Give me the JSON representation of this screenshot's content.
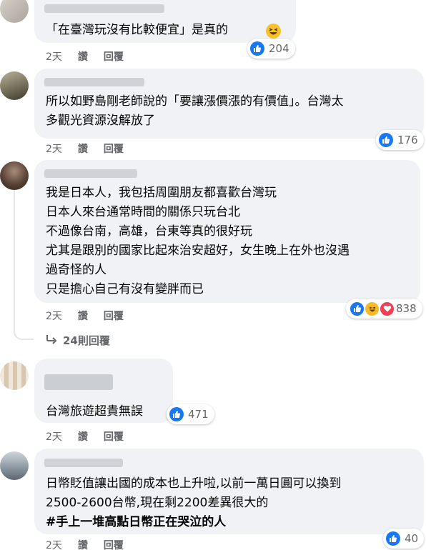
{
  "comments": [
    {
      "lines": [
        "「在臺灣玩沒有比較便宜」是真的"
      ],
      "emoji": "grin-squint-emoji",
      "time": "2天",
      "like_label": "讚",
      "reply_label": "回覆",
      "reaction_count": "204",
      "reactions": [
        "like"
      ]
    },
    {
      "lines": [
        "所以如野島剛老師說的「要讓漲價漲的有價值」。台灣太",
        "多觀光資源沒解放了"
      ],
      "time": "2天",
      "like_label": "讚",
      "reply_label": "回覆",
      "reaction_count": "176",
      "reactions": [
        "like"
      ]
    },
    {
      "lines": [
        "我是日本人，我包括周圍朋友都喜歡台灣玩",
        "日本人來台通常時間的關係只玩台北",
        "不過像台南，高雄，台東等真的很好玩",
        "尤其是跟別的國家比起來治安超好，女生晚上在外也沒遇",
        "過奇怪的人",
        "只是擔心自己有沒有變胖而已"
      ],
      "time": "2天",
      "like_label": "讚",
      "reply_label": "回覆",
      "reaction_count": "838",
      "reactions": [
        "like",
        "haha",
        "love"
      ],
      "replies_label": "24則回覆"
    },
    {
      "lines": [
        "台灣旅遊超貴無誤"
      ],
      "time": "2天",
      "like_label": "讚",
      "reply_label": "回覆",
      "reaction_count": "471",
      "reactions": [
        "like"
      ]
    },
    {
      "lines": [
        "日幣貶值讓出國的成本也上升啦,以前一萬日圓可以換到",
        "2500-2600台幣,現在剩2200差異很大的",
        "#手上一堆高點日幣正在哭泣的人"
      ],
      "time": "2天",
      "like_label": "讚",
      "reply_label": "回覆",
      "reaction_count": "40",
      "reactions": [
        "like"
      ]
    }
  ]
}
